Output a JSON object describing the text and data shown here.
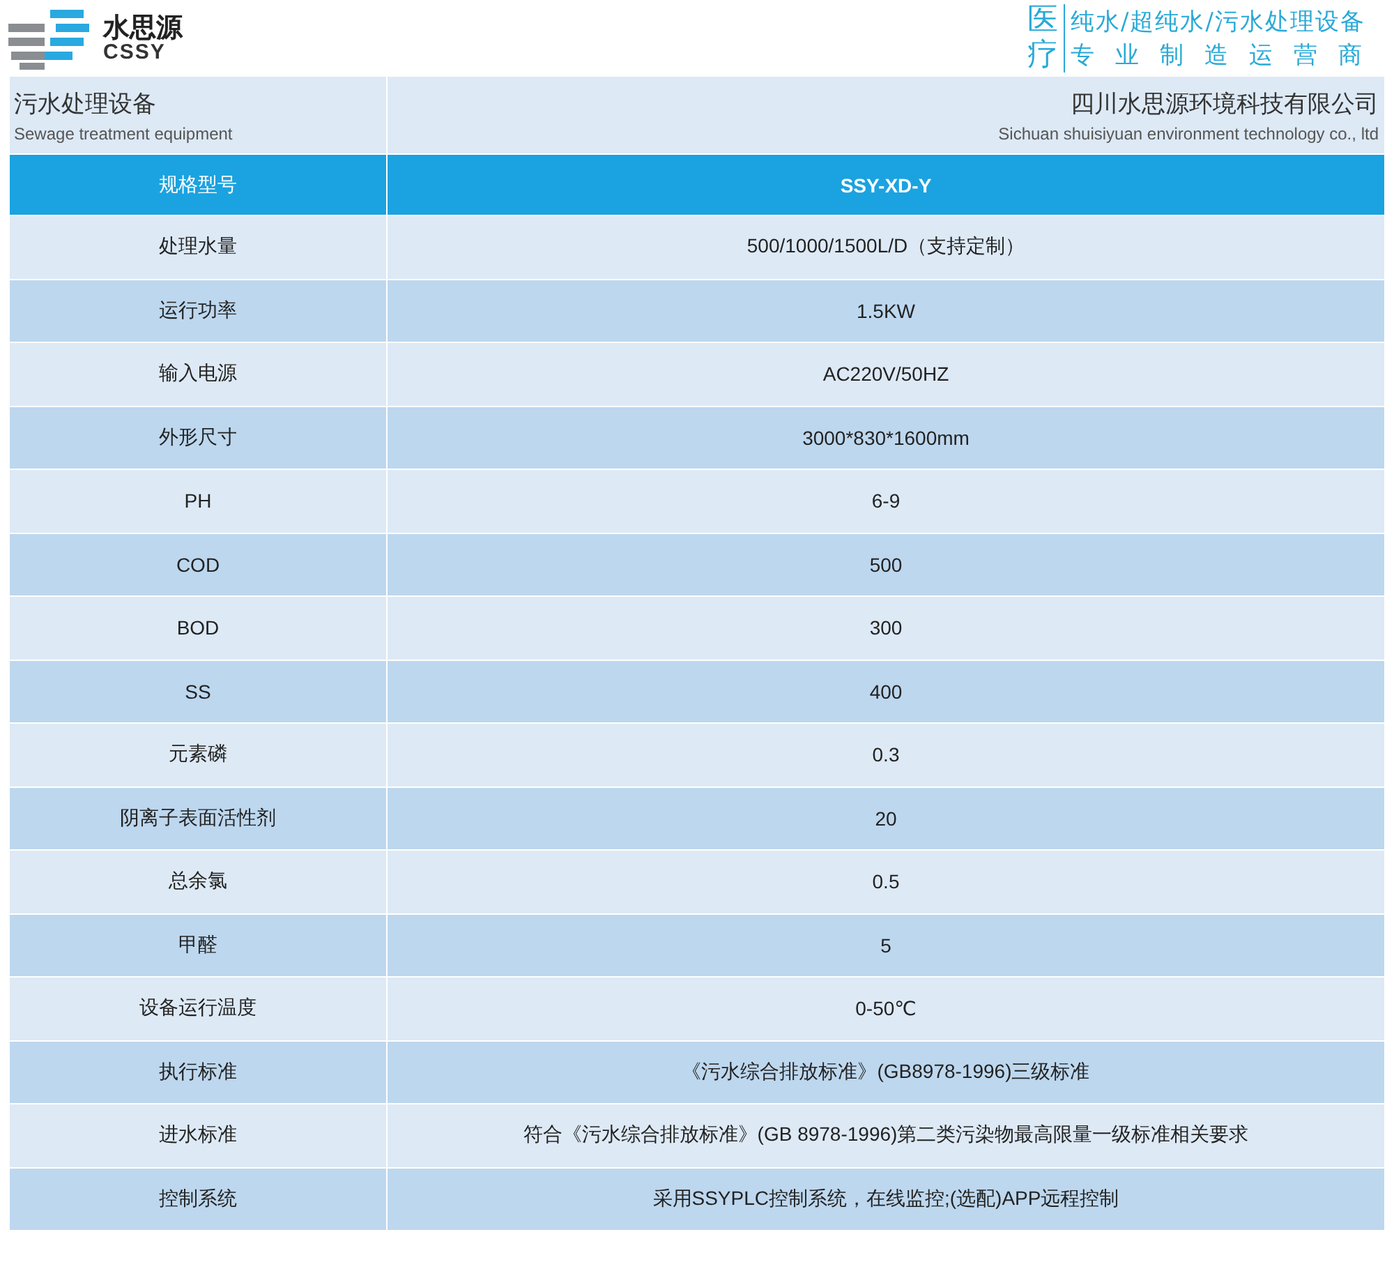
{
  "brand": {
    "name": "水思源",
    "latin": "CSSY"
  },
  "slogan": {
    "mark": "医疗",
    "lines": [
      "纯水/超纯水/污水处理设备",
      "专业制造运营商"
    ]
  },
  "company_bar": {
    "product_cn": "污水处理设备",
    "product_en": "Sewage treatment equipment",
    "company_cn": "四川水思源环境科技有限公司",
    "company_en": "Sichuan shuisiyuan environment technology co., ltd"
  },
  "table": {
    "columns": [
      "规格型号",
      "SSY-XD-Y"
    ],
    "rows": [
      [
        "处理水量",
        "500/1000/1500L/D（支持定制）"
      ],
      [
        "运行功率",
        "1.5KW"
      ],
      [
        "输入电源",
        "AC220V/50HZ"
      ],
      [
        "外形尺寸",
        "3000*830*1600mm"
      ],
      [
        "PH",
        "6-9"
      ],
      [
        "COD",
        "500"
      ],
      [
        "BOD",
        "300"
      ],
      [
        "SS",
        "400"
      ],
      [
        "元素磷",
        "0.3"
      ],
      [
        "阴离子表面活性剂",
        "20"
      ],
      [
        "总余氯",
        "0.5"
      ],
      [
        "甲醛",
        "5"
      ],
      [
        "设备运行温度",
        "0-50℃"
      ],
      [
        "执行标准",
        "《污水综合排放标准》(GB8978-1996)三级标准"
      ],
      [
        "进水标准",
        "符合《污水综合排放标准》(GB 8978-1996)第二类污染物最高限量一级标准相关要求"
      ],
      [
        "控制系统",
        "采用SSYPLC控制系统，在线监控;(选配)APP远程控制"
      ]
    ]
  }
}
